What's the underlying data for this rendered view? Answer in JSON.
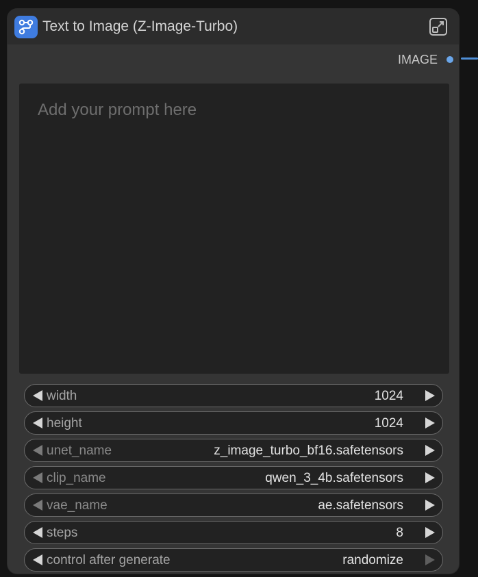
{
  "node": {
    "title": "Text to Image (Z-Image-Turbo)",
    "icon": "subgraph-icon",
    "expand_icon": "expand-icon",
    "accent_color": "#3f7ce0",
    "output": {
      "label": "IMAGE",
      "color": "#6aa6ea"
    },
    "prompt": {
      "placeholder": "Add your prompt here",
      "value": ""
    },
    "widgets": [
      {
        "label": "width",
        "value": "1024"
      },
      {
        "label": "height",
        "value": "1024"
      },
      {
        "label": "unet_name",
        "value": "z_image_turbo_bf16.safetensors"
      },
      {
        "label": "clip_name",
        "value": "qwen_3_4b.safetensors"
      },
      {
        "label": "vae_name",
        "value": "ae.safetensors"
      },
      {
        "label": "steps",
        "value": "8"
      },
      {
        "label": "control after generate",
        "value": "randomize"
      }
    ]
  }
}
